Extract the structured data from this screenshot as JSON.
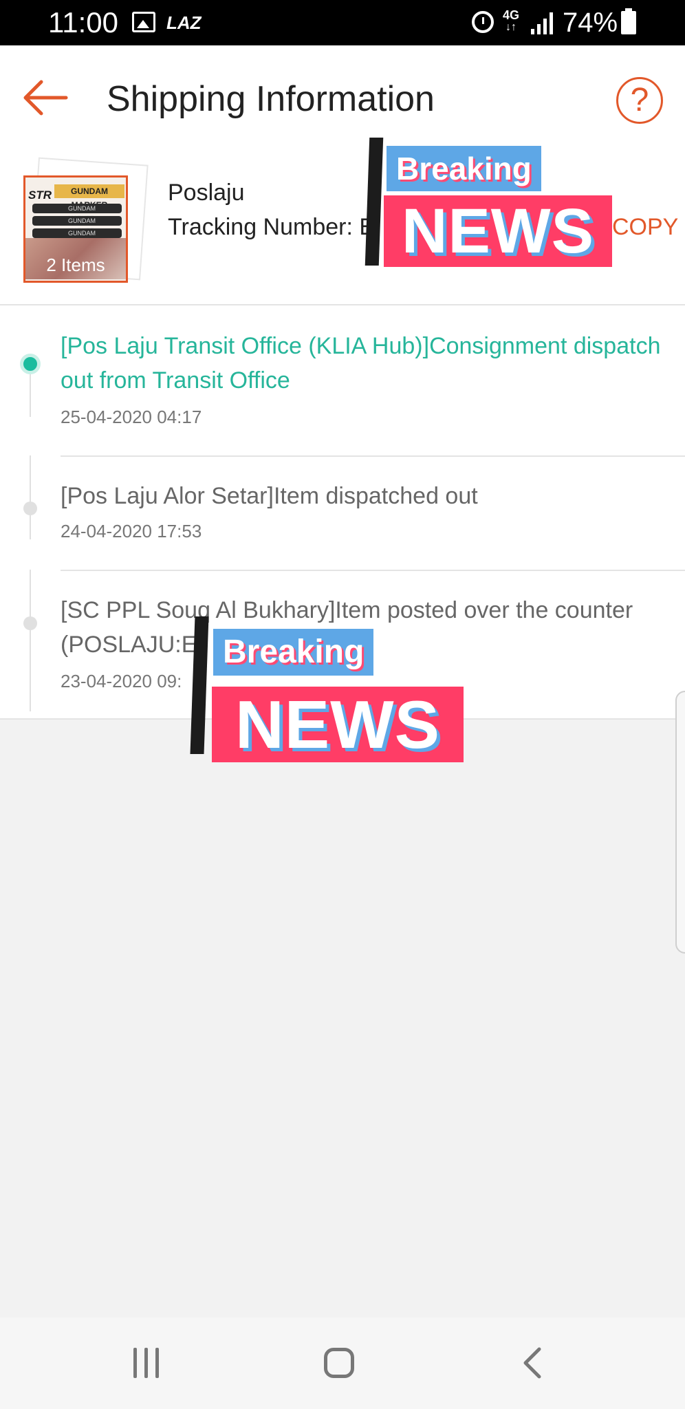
{
  "status_bar": {
    "time": "11:00",
    "icons": [
      "gallery-icon",
      "laz-icon",
      "alarm-icon",
      "network-4g-icon",
      "signal-icon",
      "battery-icon"
    ],
    "laz_label": "LAZ",
    "network_label": "4G",
    "network_arrows": "↓↑",
    "battery_percent": "74%"
  },
  "header": {
    "title": "Shipping Information",
    "back_icon": "arrow-left-icon",
    "help_icon": "question-circle-icon",
    "help_label": "?",
    "accent_color": "#e2582a"
  },
  "package": {
    "thumbnail_brand": "STR",
    "thumbnail_product": "GUNDAM MARKER",
    "thumbnail_marker_label": "GUNDAM MARKER",
    "items_count_label": "2 Items",
    "courier": "Poslaju",
    "tracking_label": "Tracking Number: E",
    "copy_label": "COPY"
  },
  "timeline": {
    "active_color": "#1bbc9e",
    "events": [
      {
        "title": "[Pos Laju Transit Office (KLIA Hub)]Consignment dispatch out from Transit Office",
        "time": "25-04-2020 04:17",
        "active": true
      },
      {
        "title": "[Pos Laju Alor Setar]Item dispatched out",
        "time": "24-04-2020 17:53",
        "active": false
      },
      {
        "title": "[SC PPL Souq Al Bukhary]Item posted over the counter (POSLAJU:E",
        "time": "23-04-2020 09:",
        "active": false
      }
    ]
  },
  "stickers": [
    {
      "line1": "Breaking",
      "line2": "NEWS"
    },
    {
      "line1": "Breaking",
      "line2": "NEWS"
    }
  ],
  "nav_bar": {
    "icons": [
      "recent-apps-icon",
      "home-icon",
      "back-icon"
    ]
  }
}
